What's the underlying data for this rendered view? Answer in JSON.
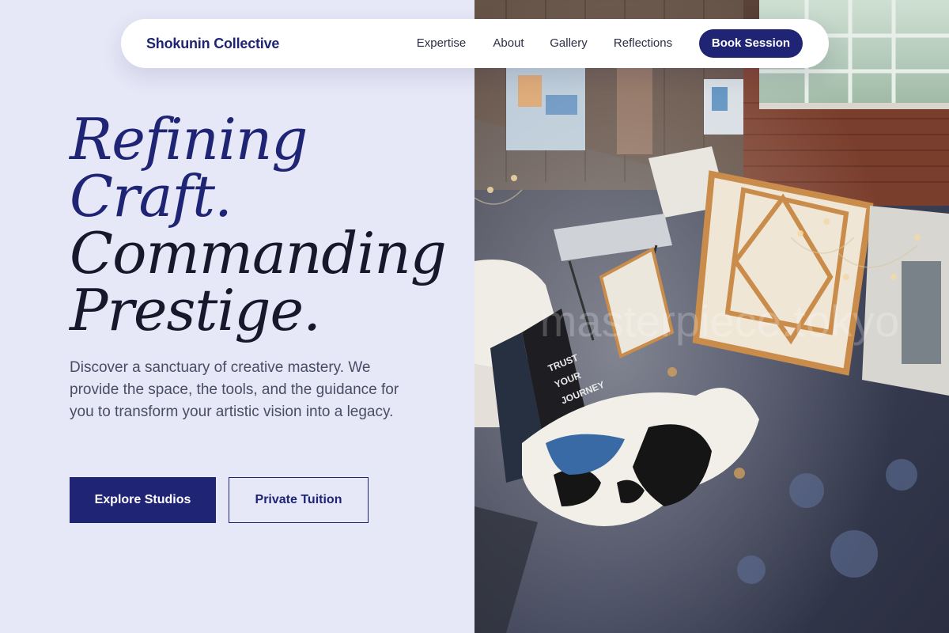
{
  "nav": {
    "brand": "Shokunin Collective",
    "links": [
      "Expertise",
      "About",
      "Gallery",
      "Reflections"
    ],
    "cta": "Book Session"
  },
  "hero": {
    "headline": [
      "Refining",
      "Craft.",
      "Commanding",
      "Prestige."
    ],
    "description": "Discover a sanctuary of creative mastery. We provide the space, the tools, and the guidance for you to transform your artistic vision into a legacy.",
    "primary_button": "Explore Studios",
    "secondary_button": "Private Tuition"
  },
  "image": {
    "watermark": "masterpiece.tokyo",
    "sign_text": [
      "TRUST",
      "YOUR",
      "JOURNEY"
    ]
  },
  "colors": {
    "accent": "#1f2574",
    "background": "#e6e8f7",
    "text_dark": "#17182c",
    "body_text": "#4a4c63"
  }
}
